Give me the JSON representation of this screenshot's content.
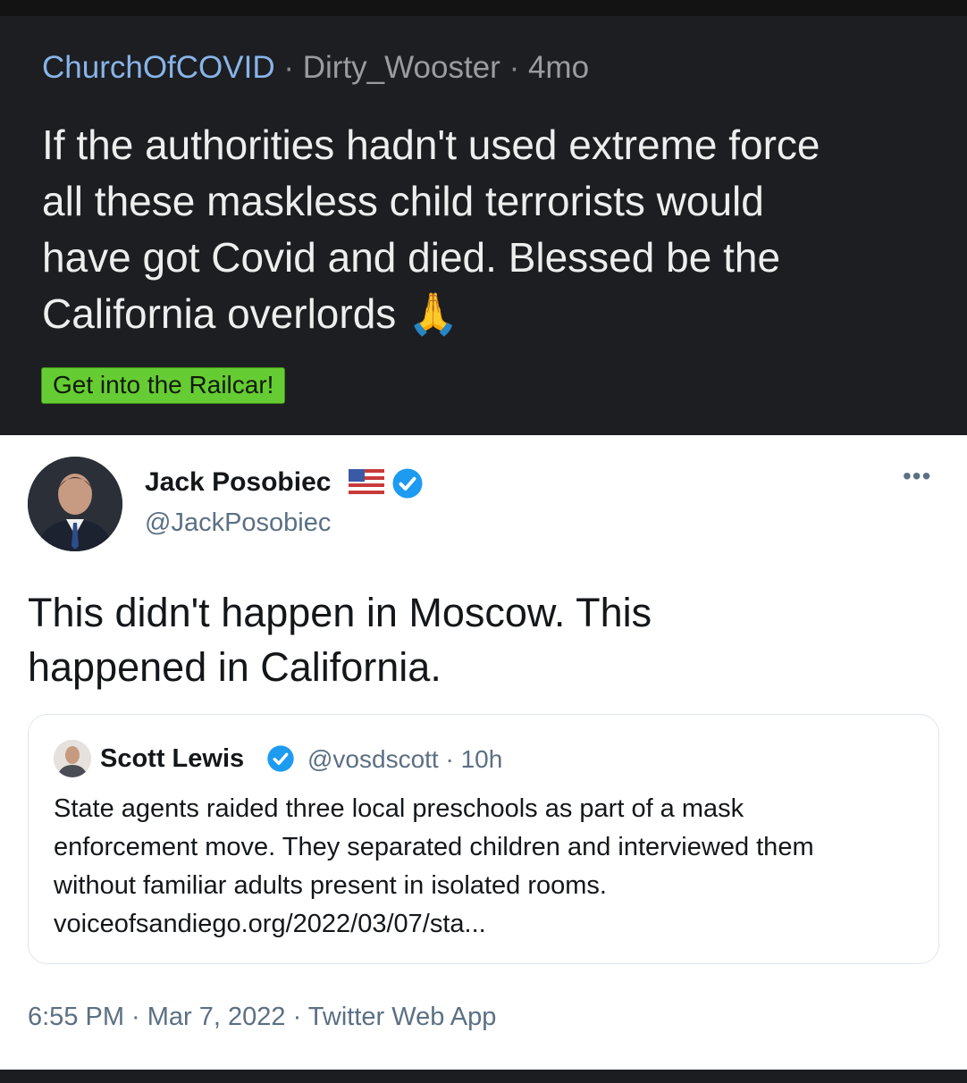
{
  "post": {
    "subreddit": "ChurchOfCOVID",
    "separator": "·",
    "author": "Dirty_Wooster",
    "age": "4mo",
    "body_lines": [
      "If the authorities hadn't used extreme force",
      "all these maskless child terrorists would",
      "have got Covid and died. Blessed be the",
      "California overlords 🙏"
    ],
    "flair": "Get into the Railcar!"
  },
  "tweet": {
    "display_name": "Jack Posobiec",
    "handle": "@JackPosobiec",
    "text_lines": [
      "This didn't happen in Moscow. This",
      "happened in California."
    ],
    "more": "•••",
    "quoted": {
      "display_name": "Scott Lewis",
      "handle": "@vosdscott",
      "separator": "·",
      "age": "10h",
      "text_lines": [
        "State agents raided three local preschools as part of a mask",
        "enforcement move. They separated children and interviewed them",
        "without familiar adults present in isolated rooms.",
        "voiceofsandiego.org/2022/03/07/sta..."
      ]
    },
    "timestamp": "6:55 PM · Mar 7, 2022 · Twitter Web App"
  },
  "icons": {
    "flag": "us-flag-icon",
    "verified": "verified-badge-icon",
    "more": "more-options-icon"
  },
  "colors": {
    "subreddit": "#88b4e8",
    "flair_bg": "#66cc33",
    "verified": "#1d9bf0",
    "reddit_bg": "#1d1e22"
  }
}
